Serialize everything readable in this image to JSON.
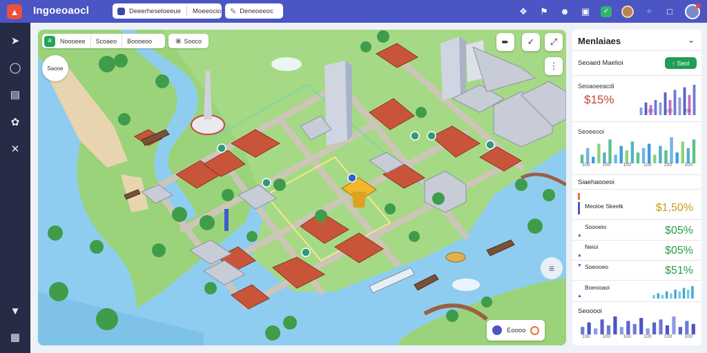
{
  "app": {
    "title": "Ingoeoaocl",
    "logo_icon": "flame-icon"
  },
  "topbar": {
    "search_segment1": "Deeerheseloeeue",
    "search_segment2": "Moeeocio",
    "tab_label": "Deneoeeoc",
    "icons": [
      "puzzle-icon",
      "bookmark-icon",
      "user-icon",
      "gift-icon",
      "tag-icon",
      "avatar",
      "info-icon",
      "chat-icon",
      "avatar"
    ]
  },
  "sidebar": {
    "icons": [
      "navigation-icon",
      "compass-icon",
      "document-icon",
      "palette-icon",
      "close-icon",
      "chevron-down-icon",
      "grid-icon"
    ]
  },
  "map": {
    "toolbar_segments": [
      "Noooeee",
      "Scoaeo",
      "Boooeoo"
    ],
    "filter_label": "Sooco",
    "badge_label": "Saooe",
    "chip_label": "Eoooo",
    "colors": {
      "water": "#8fcdf0",
      "grass": "#9bd37a",
      "road": "#c9c2b4",
      "roof": "#c8553a"
    }
  },
  "panel": {
    "title": "Menlaiaes",
    "row1_label": "Seoaed Maelioi",
    "row1_pill": "↑ Seol",
    "section1_label": "Seoaoeeacdi",
    "section1_value": "$15%",
    "section1_chart": [
      3,
      5,
      4,
      6,
      5,
      9,
      6,
      10,
      7,
      11,
      8,
      12
    ],
    "section1_ticks": [
      "100",
      "100",
      "100"
    ],
    "section2_label": "Seoeeooi",
    "section2_chart": [
      4,
      7,
      3,
      9,
      5,
      11,
      4,
      8,
      6,
      10,
      5,
      7,
      9,
      4,
      8,
      6,
      12,
      5,
      10,
      7,
      11
    ],
    "section2_ticks": [
      "100",
      "100",
      "100",
      "100",
      "100",
      "100"
    ],
    "section3_label": "Siaehaooeoi",
    "stats": [
      {
        "name": "Meoloe Skeelk",
        "value": "$1,50%"
      },
      {
        "name": "Soooeio",
        "value": "$05%"
      },
      {
        "name": "Neioi",
        "value": "$05%"
      },
      {
        "name": "Soeooeo",
        "value": "$51%"
      },
      {
        "name": "Boeooaoi",
        "value": ""
      }
    ],
    "section4_label": "Seooooi",
    "section4_chart": [
      5,
      8,
      4,
      10,
      6,
      12,
      5,
      9,
      7,
      11,
      4,
      8,
      10,
      6,
      12,
      5,
      9,
      7
    ],
    "section4_ticks": [
      "100",
      "100",
      "100",
      "100",
      "100",
      "100"
    ]
  }
}
